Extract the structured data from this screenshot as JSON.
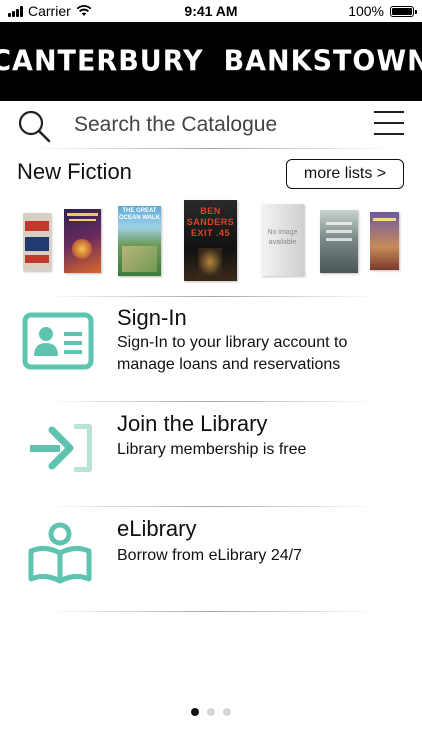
{
  "status_bar": {
    "carrier": "Carrier",
    "time": "9:41 AM",
    "battery": "100%",
    "battery_level": 1.0
  },
  "header": {
    "brand_left": "CANTERBURY",
    "brand_right": "BANKSTOWN",
    "background": "#000000"
  },
  "search": {
    "placeholder": "Search the Catalogue",
    "icon": "search-icon"
  },
  "menu": {
    "icon": "hamburger-menu-icon"
  },
  "fiction": {
    "title": "New Fiction",
    "more_label": "more lists >",
    "books": [
      {
        "cover_text": "",
        "cover_color": "#c0392b"
      },
      {
        "cover_text": "",
        "cover_color": "#2b2150"
      },
      {
        "cover_text": "THE GREAT OCEAN WALK",
        "cover_color": "#3a7f7a"
      },
      {
        "cover_text": "BEN SANDERS EXIT .45",
        "cover_color": "#222222"
      },
      {
        "cover_text": "No image available",
        "cover_color": "#dddddd"
      },
      {
        "cover_text": "",
        "cover_color": "#6e7c7c"
      },
      {
        "cover_text": "",
        "cover_color": "#a0603a"
      }
    ]
  },
  "rows": [
    {
      "title": "Sign-In",
      "description": "Sign-In to your library account to manage loans and reservations",
      "icon": "id-card-icon"
    },
    {
      "title": "Join the Library",
      "description": "Library membership is free",
      "icon": "join-arrow-icon"
    },
    {
      "title": "eLibrary",
      "description": "Borrow from eLibrary 24/7",
      "icon": "reader-book-icon"
    }
  ],
  "accent_color": "#5ec4b0",
  "pagination": {
    "pages": 3,
    "current": 1
  }
}
